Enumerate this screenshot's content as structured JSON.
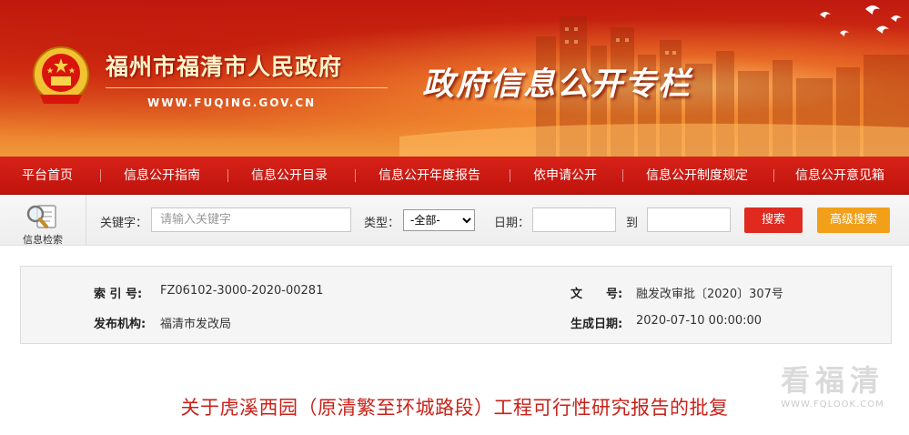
{
  "header": {
    "site_name": "福州市福清市人民政府",
    "site_url": "WWW.FUQING.GOV.CN",
    "column_title": "政府信息公开专栏"
  },
  "nav": {
    "items": [
      {
        "label": "平台首页"
      },
      {
        "label": "信息公开指南"
      },
      {
        "label": "信息公开目录"
      },
      {
        "label": "信息公开年度报告"
      },
      {
        "label": "依申请公开"
      },
      {
        "label": "信息公开制度规定"
      },
      {
        "label": "信息公开意见箱"
      }
    ]
  },
  "search": {
    "caption": "信息检索",
    "keyword_label": "关键字：",
    "keyword_placeholder": "请输入关键字",
    "keyword_value": "",
    "type_label": "类型：",
    "type_selected": "-全部-",
    "date_label": "日期：",
    "date_to_label": "到",
    "date_from_value": "",
    "date_to_value": "",
    "search_button": "搜索",
    "advanced_button": "高级搜索"
  },
  "info": {
    "index_label": "索 引 号:",
    "index_value": "FZ06102-3000-2020-00281",
    "doc_no_label": "文　　号:",
    "doc_no_value": "融发改审批〔2020〕307号",
    "publisher_label": "发布机构:",
    "publisher_value": "福清市发改局",
    "date_label": "生成日期:",
    "date_value": "2020-07-10 00:00:00"
  },
  "document": {
    "title": "关于虎溪西园（原清繁至环城路段）工程可行性研究报告的批复"
  },
  "watermark": {
    "text": "看福清",
    "url": "WWW.FQLOOK.COM"
  },
  "colors": {
    "nav_red": "#c9150e",
    "search_button": "#e02a20",
    "advanced_button": "#f2a019",
    "title_red": "#c8221a"
  }
}
